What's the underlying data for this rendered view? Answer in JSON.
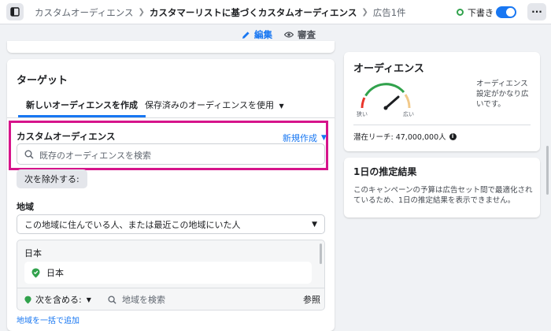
{
  "header": {
    "breadcrumbs": [
      "カスタムオーディエンス",
      "カスタマーリストに基づくカスタムオーディエンス",
      "広告1件"
    ],
    "draft_label": "下書き",
    "more_label": "···"
  },
  "mode_tabs": {
    "edit_label": "編集",
    "review_label": "審査"
  },
  "target": {
    "title": "ターゲット",
    "tab_new": "新しいオーディエンスを作成",
    "tab_saved": "保存済みのオーディエンスを使用",
    "custom_audience_label": "カスタムオーディエンス",
    "new_create_label": "新規作成",
    "search_placeholder": "既存のオーディエンスを検索",
    "exclude_label": "次を除外する:",
    "region_label": "地域",
    "region_select_value": "この地域に住んでいる人、または最近この地域にいた人",
    "country_label": "日本",
    "location_item": "日本",
    "include_label": "次を含める:",
    "location_search_placeholder": "地域を検索",
    "browse_label": "参照",
    "bulk_add_label": "地域を一括で追加"
  },
  "audience": {
    "title": "オーディエンス",
    "gauge_narrow": "狭い",
    "gauge_wide": "広い",
    "description": "オーディエンス設定がかなり広いです。",
    "reach": "潜在リーチ: 47,000,000人"
  },
  "estimate": {
    "title": "1日の推定結果",
    "text": "このキャンペーンの予算は広告セット間で最適化されているため、1日の推定結果を表示できません。"
  },
  "colors": {
    "accent": "#1877f2",
    "highlight": "#d6148b",
    "draft_green": "#31a24c",
    "gauge_green": "#31a24c"
  },
  "icons": {
    "nav": "sidebar-toggle-icon",
    "separator": "chevron-right-icon",
    "edit": "pencil-icon",
    "review": "eye-icon",
    "search": "search-icon",
    "location": "location-pin-icon",
    "info": "info-icon"
  }
}
